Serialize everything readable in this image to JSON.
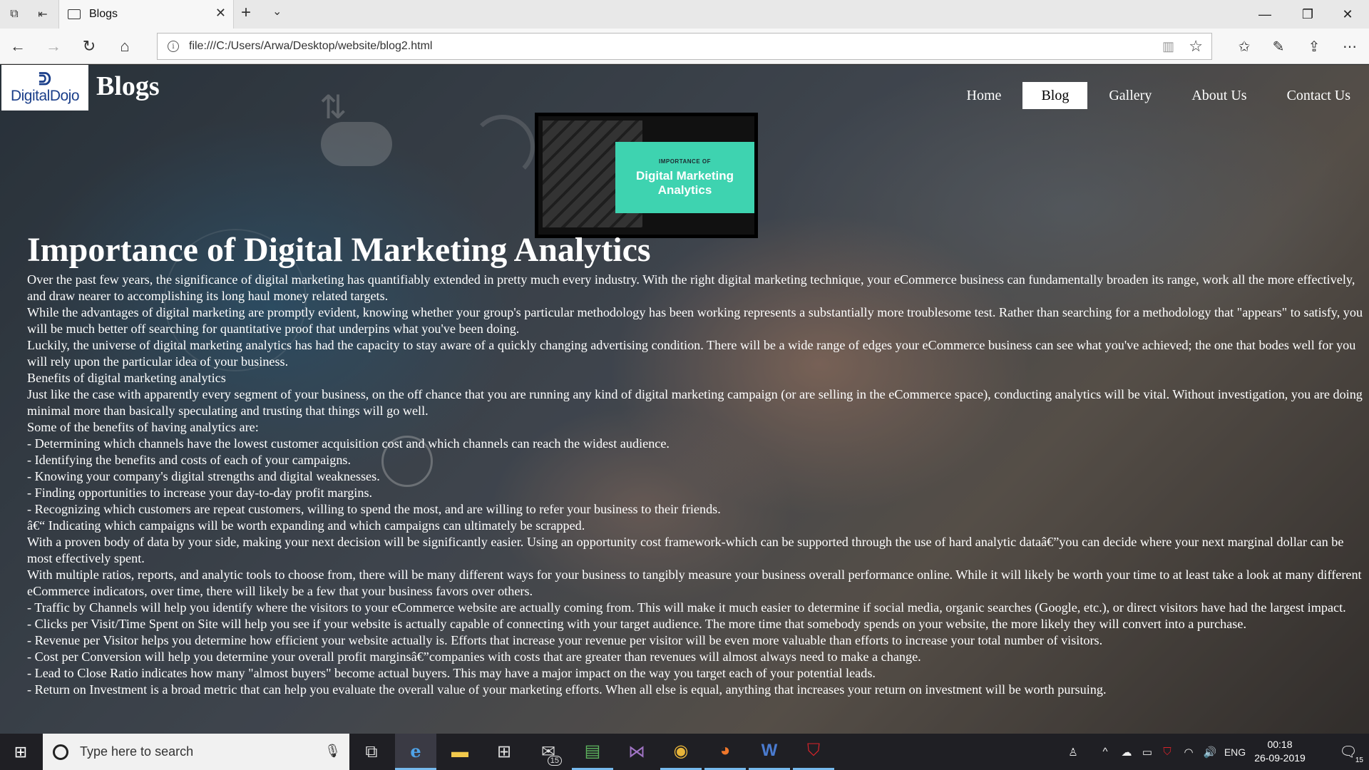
{
  "browser": {
    "tab_title": "Blogs",
    "url": "file:///C:/Users/Arwa/Desktop/website/blog2.html",
    "icons": {
      "tab_actions": "tab-actions-icon",
      "set_aside": "set-aside-tabs-icon",
      "back": "back-arrow-icon",
      "forward": "forward-arrow-icon",
      "refresh": "refresh-icon",
      "home": "home-icon",
      "favorites": "favorites-icon",
      "reading_view": "reading-view-icon",
      "notes": "web-note-icon",
      "share": "share-icon",
      "more": "more-icon"
    }
  },
  "site": {
    "logo_text": "DigitalDojo",
    "title": "Blogs",
    "nav": [
      {
        "label": "Home",
        "active": false
      },
      {
        "label": "Blog",
        "active": true
      },
      {
        "label": "Gallery",
        "active": false
      },
      {
        "label": "About Us",
        "active": false
      },
      {
        "label": "Contact Us",
        "active": false
      }
    ],
    "hero": {
      "kicker": "IMPORTANCE OF",
      "title": "Digital Marketing Analytics"
    }
  },
  "article": {
    "heading": "Importance of Digital Marketing Analytics",
    "paragraphs": [
      "Over the past few years, the significance of digital marketing has quantifiably extended in pretty much every industry. With the right digital marketing technique, your eCommerce business can fundamentally broaden its range, work all the more effectively, and draw nearer to accomplishing its long haul money related targets.",
      "While the advantages of digital marketing are promptly evident, knowing whether your group's particular methodology has been working represents a substantially more troublesome test. Rather than searching for a methodology that \"appears\" to satisfy, you will be much better off searching for quantitative proof that underpins what you've been doing.",
      "Luckily, the universe of digital marketing analytics has had the capacity to stay aware of a quickly changing advertising condition. There will be a wide range of edges your eCommerce business can see what you've achieved; the one that bodes well for you will rely upon the particular idea of your business.",
      "Benefits of digital marketing analytics",
      "Just like the case with apparently every segment of your business, on the off chance that you are running any kind of digital marketing campaign (or are selling in the eCommerce space), conducting analytics will be vital. Without investigation, you are doing minimal more than basically speculating and trusting that things will go well.",
      "Some of the benefits of having analytics are:",
      "- Determining which channels have the lowest customer acquisition cost and which channels can reach the widest audience.",
      "- Identifying the benefits and costs of each of your campaigns.",
      "- Knowing your company's digital strengths and digital weaknesses.",
      "- Finding opportunities to increase your day-to-day profit margins.",
      "- Recognizing which customers are repeat customers, willing to spend the most, and are willing to refer your business to their friends.",
      "â€“ Indicating which campaigns will be worth expanding and which campaigns can ultimately be scrapped.",
      "With a proven body of data by your side, making your next decision will be significantly easier. Using an opportunity cost framework-which can be supported through the use of hard analytic dataâ€”you can decide where your next marginal dollar can be most effectively spent.",
      "With multiple ratios, reports, and analytic tools to choose from, there will be many different ways for your business to tangibly measure your business overall performance online. While it will likely be worth your time to at least take a look at many different eCommerce indicators, over time, there will likely be a few that your business favors over others.",
      "- Traffic by Channels will help you identify where the visitors to your eCommerce website are actually coming from. This will make it much easier to determine if social media, organic searches (Google, etc.), or direct visitors have had the largest impact.",
      "- Clicks per Visit/Time Spent on Site will help you see if your website is actually capable of connecting with your target audience. The more time that somebody spends on your website, the more likely they will convert into a purchase.",
      "- Revenue per Visitor helps you determine how efficient your website actually is. Efforts that increase your revenue per visitor will be even more valuable than efforts to increase your total number of visitors.",
      "- Cost per Conversion will help you determine your overall profit marginsâ€”companies with costs that are greater than revenues will almost always need to make a change.",
      "- Lead to Close Ratio indicates how many \"almost buyers\" become actual buyers. This may have a major impact on the way you target each of your potential leads.",
      "- Return on Investment is a broad metric that can help you evaluate the overall value of your marketing efforts. When all else is equal, anything that increases your return on investment will be worth pursuing."
    ]
  },
  "taskbar": {
    "search_placeholder": "Type here to search",
    "apps": [
      "edge-icon",
      "file-explorer-icon",
      "store-icon",
      "mail-icon",
      "spreadsheet-icon",
      "visual-studio-icon",
      "chrome-icon",
      "firefox-icon",
      "word-icon",
      "mcafee-icon"
    ],
    "mail_badge": "15",
    "language": "ENG",
    "time": "00:18",
    "date": "26-09-2019",
    "notification_count": "15"
  }
}
